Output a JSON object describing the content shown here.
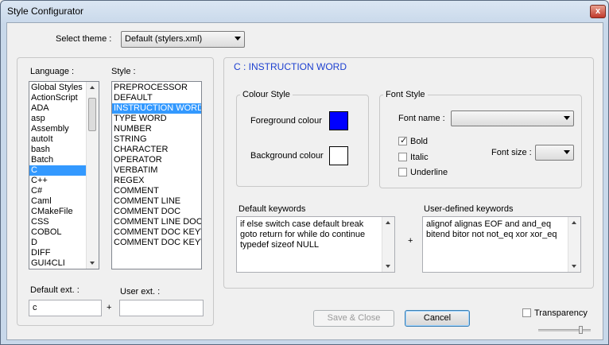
{
  "window": {
    "title": "Style Configurator",
    "close_glyph": "x"
  },
  "theme": {
    "label": "Select theme :",
    "value": "Default (stylers.xml)"
  },
  "language": {
    "label": "Language :",
    "items": [
      "Global Styles",
      "ActionScript",
      "ADA",
      "asp",
      "Assembly",
      "autoIt",
      "bash",
      "Batch",
      "C",
      "C++",
      "C#",
      "Caml",
      "CMakeFile",
      "CSS",
      "COBOL",
      "D",
      "DIFF",
      "GUI4CLI"
    ],
    "selected": "C"
  },
  "style": {
    "label": "Style :",
    "items": [
      "PREPROCESSOR",
      "DEFAULT",
      "INSTRUCTION WORD",
      "TYPE WORD",
      "NUMBER",
      "STRING",
      "CHARACTER",
      "OPERATOR",
      "VERBATIM",
      "REGEX",
      "COMMENT",
      "COMMENT LINE",
      "COMMENT DOC",
      "COMMENT LINE DOC",
      "COMMENT DOC KEYWORD",
      "COMMENT DOC KEYWORD ERROR"
    ],
    "selected": "INSTRUCTION WORD"
  },
  "ext": {
    "default_label": "Default ext. :",
    "default_value": "c",
    "plus": "+",
    "user_label": "User ext. :",
    "user_value": ""
  },
  "style_panel": {
    "heading": "C : INSTRUCTION WORD",
    "heading_color": "#1c3fd0"
  },
  "colour_style": {
    "label": "Colour Style",
    "foreground_label": "Foreground colour",
    "foreground_color": "#0000ff",
    "background_label": "Background colour",
    "background_color": "#ffffff"
  },
  "font_style": {
    "label": "Font Style",
    "font_name_label": "Font name :",
    "font_name_value": "",
    "font_size_label": "Font size :",
    "font_size_value": "",
    "bold_label": "Bold",
    "bold_checked": true,
    "italic_label": "Italic",
    "italic_checked": false,
    "underline_label": "Underline",
    "underline_checked": false
  },
  "keywords": {
    "default_label": "Default keywords",
    "default_text": "if else switch case default break goto return for while do continue typedef sizeof NULL",
    "plus": "+",
    "user_label": "User-defined keywords",
    "user_text": "alignof alignas EOF and and_eq bitend bitor not not_eq xor xor_eq"
  },
  "buttons": {
    "save_close": "Save & Close",
    "cancel": "Cancel"
  },
  "transparency": {
    "label": "Transparency",
    "checked": false,
    "slider_level": 0.8
  }
}
